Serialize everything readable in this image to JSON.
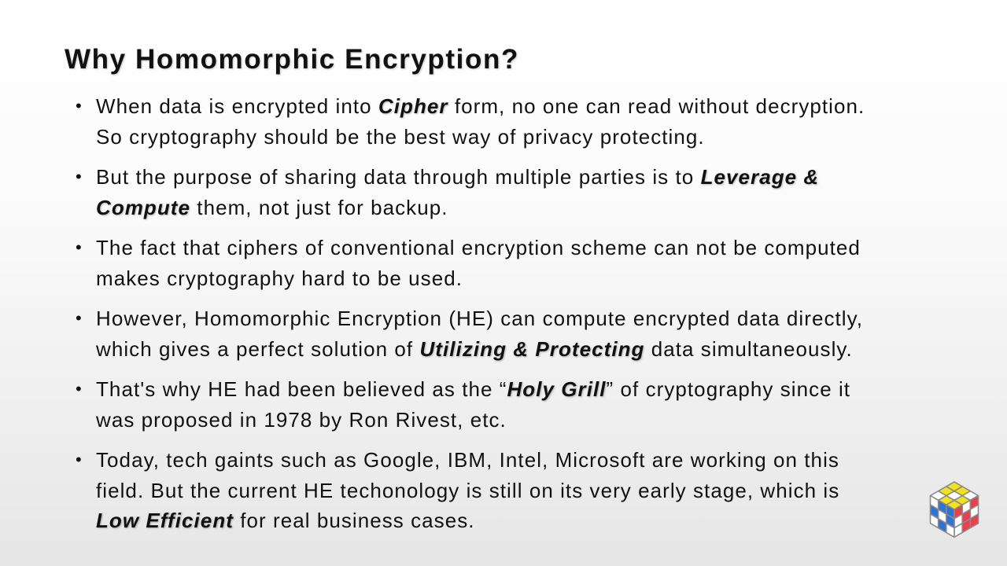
{
  "slide": {
    "title": "Why Homomorphic Encryption?",
    "bullets": [
      {
        "lines": [
          [
            "When data is encrypted into ",
            "Cipher",
            " form, no one can read without decryption."
          ],
          [
            "So cryptography should be the best way of privacy protecting."
          ]
        ]
      },
      {
        "lines": [
          [
            "But the purpose of sharing data through multiple parties is to ",
            "Leverage &"
          ],
          [
            "Compute",
            " them, not just for backup."
          ]
        ]
      },
      {
        "lines": [
          [
            "The fact that ciphers of conventional encryption scheme can not be computed"
          ],
          [
            "makes cryptography hard to be used."
          ]
        ]
      },
      {
        "lines": [
          [
            "However, Homomorphic Encryption (HE) can compute encrypted data directly,"
          ],
          [
            "which gives a perfect solution of ",
            "Utilizing & Protecting",
            " data simultaneously."
          ]
        ]
      },
      {
        "lines": [
          [
            "That's why HE had been believed as the “",
            "Holy Grill",
            "” of cryptography since it"
          ],
          [
            "was proposed in 1978 by Ron Rivest, etc."
          ]
        ]
      },
      {
        "lines": [
          [
            "Today, tech gaints such as Google, IBM, Intel, Microsoft are working on this"
          ],
          [
            "field. But the current HE techonology is still on its very early stage, which is"
          ],
          [
            "Low Efficient",
            " for real business cases."
          ]
        ]
      }
    ]
  },
  "logo": {
    "icon": "rubiks-cube-icon",
    "colors": {
      "top": "#f2e21e",
      "left": "#e8404d",
      "right": "#2d74d6",
      "white": "#ffffff",
      "grid": "#8a8a8a"
    }
  }
}
